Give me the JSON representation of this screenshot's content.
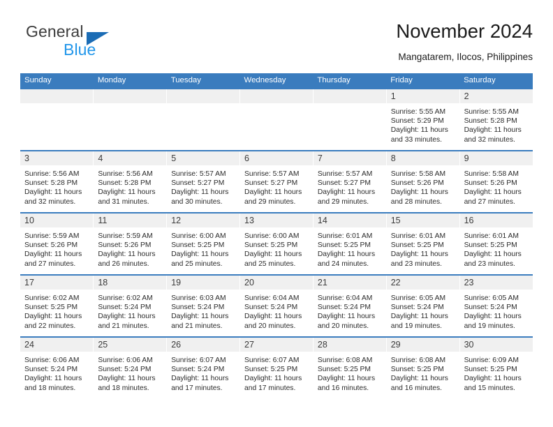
{
  "brand": {
    "name_top": "General",
    "name_bottom": "Blue",
    "triangle_color": "#1b6cb5",
    "blue_color": "#2196ea"
  },
  "header": {
    "title": "November 2024",
    "subtitle": "Mangatarem, Ilocos, Philippines"
  },
  "theme": {
    "header_blue": "#3a7cbe",
    "daynum_strip": "#f0f0f0",
    "text": "#2b2b2b"
  },
  "weekdays": [
    "Sunday",
    "Monday",
    "Tuesday",
    "Wednesday",
    "Thursday",
    "Friday",
    "Saturday"
  ],
  "labels": {
    "sunrise": "Sunrise:",
    "sunset": "Sunset:",
    "daylight": "Daylight:"
  },
  "weeks": [
    [
      {
        "day": ""
      },
      {
        "day": ""
      },
      {
        "day": ""
      },
      {
        "day": ""
      },
      {
        "day": ""
      },
      {
        "day": "1",
        "sunrise": "Sunrise: 5:55 AM",
        "sunset": "Sunset: 5:29 PM",
        "daylight_1": "Daylight: 11 hours",
        "daylight_2": "and 33 minutes."
      },
      {
        "day": "2",
        "sunrise": "Sunrise: 5:55 AM",
        "sunset": "Sunset: 5:28 PM",
        "daylight_1": "Daylight: 11 hours",
        "daylight_2": "and 32 minutes."
      }
    ],
    [
      {
        "day": "3",
        "sunrise": "Sunrise: 5:56 AM",
        "sunset": "Sunset: 5:28 PM",
        "daylight_1": "Daylight: 11 hours",
        "daylight_2": "and 32 minutes."
      },
      {
        "day": "4",
        "sunrise": "Sunrise: 5:56 AM",
        "sunset": "Sunset: 5:28 PM",
        "daylight_1": "Daylight: 11 hours",
        "daylight_2": "and 31 minutes."
      },
      {
        "day": "5",
        "sunrise": "Sunrise: 5:57 AM",
        "sunset": "Sunset: 5:27 PM",
        "daylight_1": "Daylight: 11 hours",
        "daylight_2": "and 30 minutes."
      },
      {
        "day": "6",
        "sunrise": "Sunrise: 5:57 AM",
        "sunset": "Sunset: 5:27 PM",
        "daylight_1": "Daylight: 11 hours",
        "daylight_2": "and 29 minutes."
      },
      {
        "day": "7",
        "sunrise": "Sunrise: 5:57 AM",
        "sunset": "Sunset: 5:27 PM",
        "daylight_1": "Daylight: 11 hours",
        "daylight_2": "and 29 minutes."
      },
      {
        "day": "8",
        "sunrise": "Sunrise: 5:58 AM",
        "sunset": "Sunset: 5:26 PM",
        "daylight_1": "Daylight: 11 hours",
        "daylight_2": "and 28 minutes."
      },
      {
        "day": "9",
        "sunrise": "Sunrise: 5:58 AM",
        "sunset": "Sunset: 5:26 PM",
        "daylight_1": "Daylight: 11 hours",
        "daylight_2": "and 27 minutes."
      }
    ],
    [
      {
        "day": "10",
        "sunrise": "Sunrise: 5:59 AM",
        "sunset": "Sunset: 5:26 PM",
        "daylight_1": "Daylight: 11 hours",
        "daylight_2": "and 27 minutes."
      },
      {
        "day": "11",
        "sunrise": "Sunrise: 5:59 AM",
        "sunset": "Sunset: 5:26 PM",
        "daylight_1": "Daylight: 11 hours",
        "daylight_2": "and 26 minutes."
      },
      {
        "day": "12",
        "sunrise": "Sunrise: 6:00 AM",
        "sunset": "Sunset: 5:25 PM",
        "daylight_1": "Daylight: 11 hours",
        "daylight_2": "and 25 minutes."
      },
      {
        "day": "13",
        "sunrise": "Sunrise: 6:00 AM",
        "sunset": "Sunset: 5:25 PM",
        "daylight_1": "Daylight: 11 hours",
        "daylight_2": "and 25 minutes."
      },
      {
        "day": "14",
        "sunrise": "Sunrise: 6:01 AM",
        "sunset": "Sunset: 5:25 PM",
        "daylight_1": "Daylight: 11 hours",
        "daylight_2": "and 24 minutes."
      },
      {
        "day": "15",
        "sunrise": "Sunrise: 6:01 AM",
        "sunset": "Sunset: 5:25 PM",
        "daylight_1": "Daylight: 11 hours",
        "daylight_2": "and 23 minutes."
      },
      {
        "day": "16",
        "sunrise": "Sunrise: 6:01 AM",
        "sunset": "Sunset: 5:25 PM",
        "daylight_1": "Daylight: 11 hours",
        "daylight_2": "and 23 minutes."
      }
    ],
    [
      {
        "day": "17",
        "sunrise": "Sunrise: 6:02 AM",
        "sunset": "Sunset: 5:25 PM",
        "daylight_1": "Daylight: 11 hours",
        "daylight_2": "and 22 minutes."
      },
      {
        "day": "18",
        "sunrise": "Sunrise: 6:02 AM",
        "sunset": "Sunset: 5:24 PM",
        "daylight_1": "Daylight: 11 hours",
        "daylight_2": "and 21 minutes."
      },
      {
        "day": "19",
        "sunrise": "Sunrise: 6:03 AM",
        "sunset": "Sunset: 5:24 PM",
        "daylight_1": "Daylight: 11 hours",
        "daylight_2": "and 21 minutes."
      },
      {
        "day": "20",
        "sunrise": "Sunrise: 6:04 AM",
        "sunset": "Sunset: 5:24 PM",
        "daylight_1": "Daylight: 11 hours",
        "daylight_2": "and 20 minutes."
      },
      {
        "day": "21",
        "sunrise": "Sunrise: 6:04 AM",
        "sunset": "Sunset: 5:24 PM",
        "daylight_1": "Daylight: 11 hours",
        "daylight_2": "and 20 minutes."
      },
      {
        "day": "22",
        "sunrise": "Sunrise: 6:05 AM",
        "sunset": "Sunset: 5:24 PM",
        "daylight_1": "Daylight: 11 hours",
        "daylight_2": "and 19 minutes."
      },
      {
        "day": "23",
        "sunrise": "Sunrise: 6:05 AM",
        "sunset": "Sunset: 5:24 PM",
        "daylight_1": "Daylight: 11 hours",
        "daylight_2": "and 19 minutes."
      }
    ],
    [
      {
        "day": "24",
        "sunrise": "Sunrise: 6:06 AM",
        "sunset": "Sunset: 5:24 PM",
        "daylight_1": "Daylight: 11 hours",
        "daylight_2": "and 18 minutes."
      },
      {
        "day": "25",
        "sunrise": "Sunrise: 6:06 AM",
        "sunset": "Sunset: 5:24 PM",
        "daylight_1": "Daylight: 11 hours",
        "daylight_2": "and 18 minutes."
      },
      {
        "day": "26",
        "sunrise": "Sunrise: 6:07 AM",
        "sunset": "Sunset: 5:24 PM",
        "daylight_1": "Daylight: 11 hours",
        "daylight_2": "and 17 minutes."
      },
      {
        "day": "27",
        "sunrise": "Sunrise: 6:07 AM",
        "sunset": "Sunset: 5:25 PM",
        "daylight_1": "Daylight: 11 hours",
        "daylight_2": "and 17 minutes."
      },
      {
        "day": "28",
        "sunrise": "Sunrise: 6:08 AM",
        "sunset": "Sunset: 5:25 PM",
        "daylight_1": "Daylight: 11 hours",
        "daylight_2": "and 16 minutes."
      },
      {
        "day": "29",
        "sunrise": "Sunrise: 6:08 AM",
        "sunset": "Sunset: 5:25 PM",
        "daylight_1": "Daylight: 11 hours",
        "daylight_2": "and 16 minutes."
      },
      {
        "day": "30",
        "sunrise": "Sunrise: 6:09 AM",
        "sunset": "Sunset: 5:25 PM",
        "daylight_1": "Daylight: 11 hours",
        "daylight_2": "and 15 minutes."
      }
    ]
  ]
}
